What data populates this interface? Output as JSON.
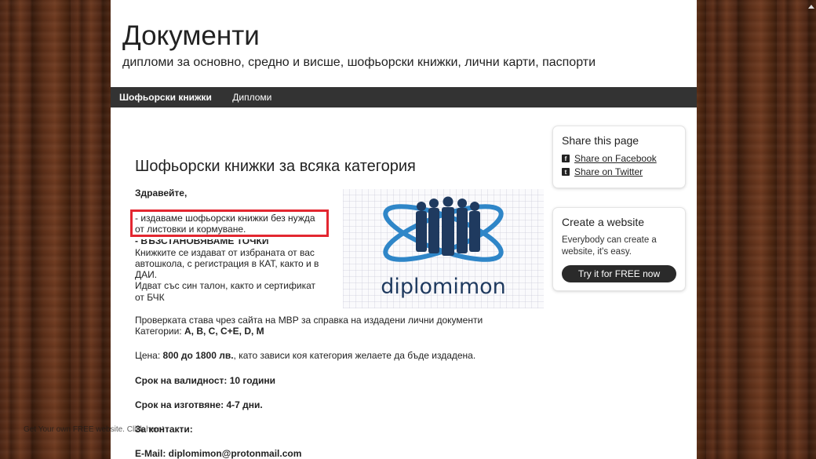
{
  "header": {
    "title": "Документи",
    "subtitle": "дипломи за основно, средно и висше, шофьорски книжки, лични карти, паспорти"
  },
  "nav": {
    "items": [
      {
        "label": "Шофьорски книжки"
      },
      {
        "label": "Дипломи"
      }
    ]
  },
  "article": {
    "heading": "Шофьорски книжки за всяка категория",
    "greeting": "Здравейте,",
    "line1": "- издаваме шофьорски книжки без нужда",
    "line2": "от листовки и кормуване.",
    "line3": "- ВЪЗСТАНОВЯВАМЕ ТОЧКИ",
    "line4": "Книжките се издават от избраната от вас",
    "line5": "автошкола, с регистрация в КАТ, както и в",
    "line6": "ДАИ.",
    "line7": "Идват със син талон, както и сертификат",
    "line8": "от БЧК",
    "check_line": "Проверката става чрез сайта на МВР за справка на издадени лични документи",
    "categories_label": "Категории: ",
    "categories_value": " A, B, C, C+E, D, M",
    "price_label": "Цена: ",
    "price_value": "800 до 1800 лв.",
    "price_rest": ", като зависи коя категория желаете да бъде издадена.",
    "validity": "Срок на валидност:  10 години",
    "production": "Срок на изготвяне: 4-7 дни.",
    "contacts": "За контакти:",
    "email": "E-Mail: diplomimon@protonmail.com",
    "image_brand": "diplomimon"
  },
  "share": {
    "title": "Share this page",
    "facebook": "Share on Facebook",
    "twitter": "Share on Twitter",
    "facebook_icon": "facebook-icon",
    "twitter_icon": "twitter-icon"
  },
  "create": {
    "title": "Create a website",
    "text": "Everybody can create a website, it's easy.",
    "button": "Try it for FREE now"
  },
  "footer": {
    "note": "Get Your own FREE website. Click here!"
  },
  "colors": {
    "nav_bg": "#333333",
    "highlight_border": "#e32730",
    "logo_blue": "#2f86c8",
    "logo_navy": "#1f3a5f"
  }
}
